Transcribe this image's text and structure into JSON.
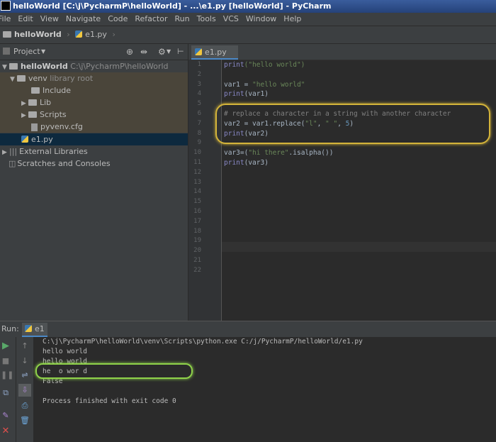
{
  "window": {
    "title": "helloWorld [C:\\j\\PycharmP\\helloWorld] - ...\\e1.py [helloWorld] - PyCharm"
  },
  "menu": [
    "File",
    "Edit",
    "View",
    "Navigate",
    "Code",
    "Refactor",
    "Run",
    "Tools",
    "VCS",
    "Window",
    "Help"
  ],
  "breadcrumb": {
    "project": "helloWorld",
    "file": "e1.py"
  },
  "project_panel": {
    "title": "Project",
    "tree": [
      {
        "label": "helloWorld",
        "detail": "C:\\j\\PycharmP\\helloWorld"
      },
      {
        "label": "venv",
        "detail": "library root"
      },
      {
        "label": "Include"
      },
      {
        "label": "Lib"
      },
      {
        "label": "Scripts"
      },
      {
        "label": "pyvenv.cfg"
      },
      {
        "label": "e1.py"
      },
      {
        "label": "External Libraries"
      },
      {
        "label": "Scratches and Consoles"
      }
    ]
  },
  "editor": {
    "tab": "e1.py",
    "line_numbers": [
      "1",
      "2",
      "3",
      "4",
      "5",
      "6",
      "7",
      "8",
      "9",
      "10",
      "11",
      "12",
      "13",
      "14",
      "15",
      "16",
      "17",
      "18",
      "19",
      "20",
      "21",
      "22"
    ],
    "lines": [
      [
        {
          "t": "print",
          "c": "kw"
        },
        {
          "t": "(\"hello world\")",
          "c": "str"
        }
      ],
      [],
      [
        {
          "t": "var1 = "
        },
        {
          "t": "\"hello world\"",
          "c": "str"
        }
      ],
      [
        {
          "t": "print",
          "c": "kw"
        },
        {
          "t": "(var1)"
        }
      ],
      [],
      [
        {
          "t": "# replace a character in a string with another character",
          "c": "cmt"
        }
      ],
      [
        {
          "t": "var2 = var1.replace("
        },
        {
          "t": "\"l\"",
          "c": "str"
        },
        {
          "t": ", "
        },
        {
          "t": "\" \"",
          "c": "str"
        },
        {
          "t": ", "
        },
        {
          "t": "5",
          "c": "num"
        },
        {
          "t": ")"
        }
      ],
      [
        {
          "t": "print",
          "c": "kw"
        },
        {
          "t": "(var2)"
        }
      ],
      [],
      [
        {
          "t": "var3=("
        },
        {
          "t": "\"hi there\"",
          "c": "str"
        },
        {
          "t": ".isalpha())"
        }
      ],
      [
        {
          "t": "print",
          "c": "kw"
        },
        {
          "t": "(var3)"
        }
      ],
      [],
      [],
      [],
      [],
      [],
      [],
      [],
      [],
      [],
      [],
      []
    ]
  },
  "run_panel": {
    "label": "Run:",
    "tab": "e1",
    "output": [
      "C:\\j\\PycharmP\\helloWorld\\venv\\Scripts\\python.exe C:/j/PycharmP/helloWorld/e1.py",
      "hello world",
      "hello world",
      "he  o wor d",
      "False",
      "",
      "Process finished with exit code 0"
    ]
  },
  "colors": {
    "highlight_code": "#d4b43a",
    "highlight_output": "#8fd24a",
    "accent": "#4a88c7"
  }
}
